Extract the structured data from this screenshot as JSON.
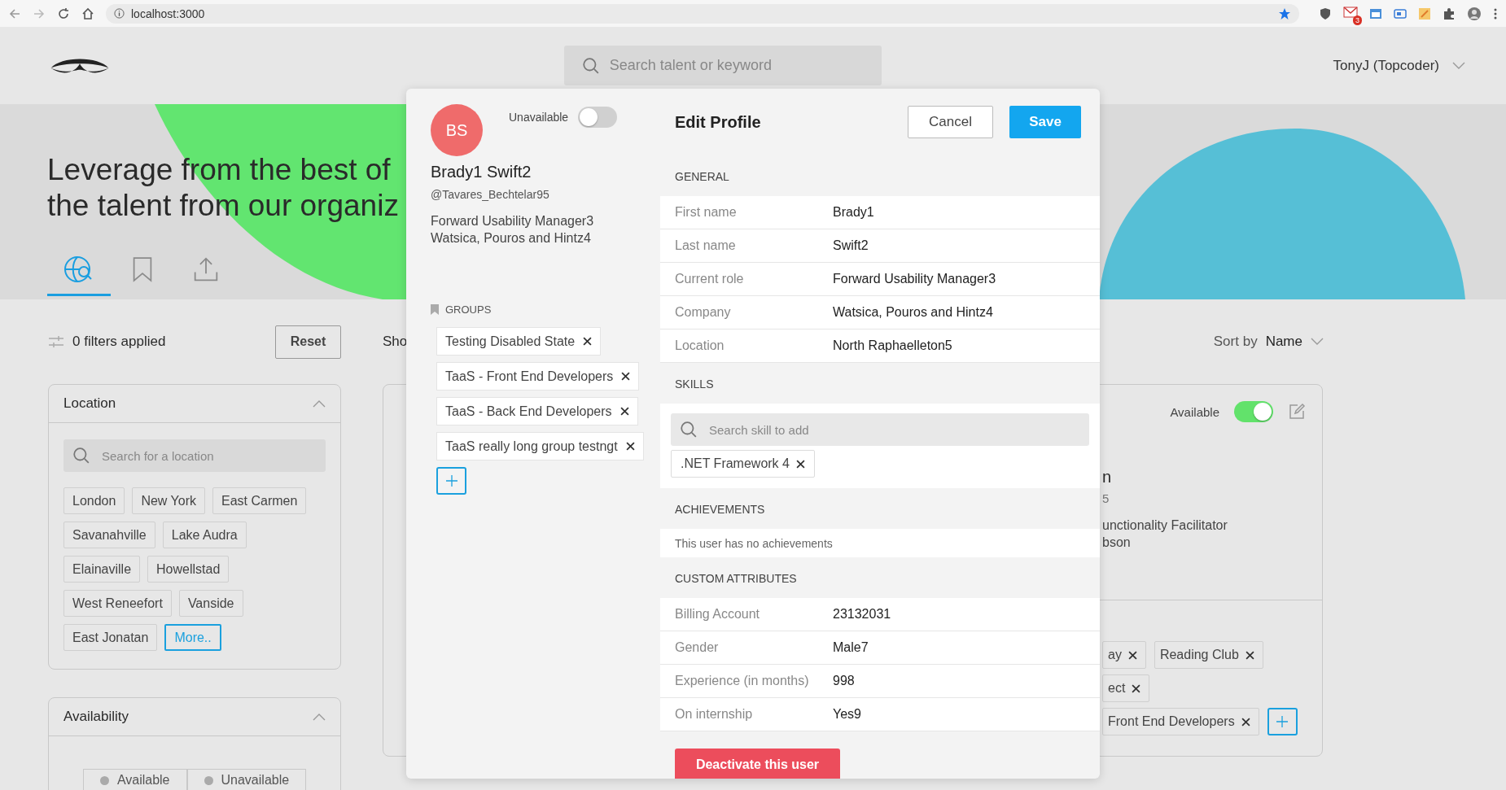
{
  "browser": {
    "url": "localhost:3000",
    "mail_badge": "3"
  },
  "header": {
    "search": {
      "placeholder": "Search talent or keyword"
    },
    "user": "TonyJ (Topcoder)"
  },
  "hero": {
    "headline_lines": [
      "Leverage from the best of",
      "the talent from our organiz"
    ],
    "tabs": [
      {
        "kind": "search",
        "selected": true
      },
      {
        "kind": "bookmark",
        "selected": false
      },
      {
        "kind": "upload",
        "selected": false
      }
    ]
  },
  "filters": {
    "summary": "0 filters applied",
    "reset": "Reset",
    "location": {
      "title": "Location",
      "expanded": true,
      "search": {
        "placeholder": "Search for a location"
      },
      "chips": [
        "London",
        "New York",
        "East Carmen",
        "Savanahville",
        "Lake Audra",
        "Elainaville",
        "Howellstad",
        "West Reneefort",
        "Vanside",
        "East Jonatan"
      ],
      "more": "More.."
    },
    "availability": {
      "title": "Availability",
      "expanded": true,
      "options": [
        {
          "label": "Available",
          "selected": false
        },
        {
          "label": "Unavailable",
          "selected": false
        }
      ]
    }
  },
  "results": {
    "summary": "Sho",
    "sort": {
      "label": "Sort by",
      "value": "Name"
    },
    "card": {
      "availability": {
        "label": "Available",
        "on": true
      },
      "name": "n",
      "handle": "5",
      "role": "unctionality Facilitator",
      "company": "bson",
      "groups": [
        "ay",
        "Reading Club",
        "ect",
        "Front End Developers"
      ]
    }
  },
  "modal": {
    "avatar": "BS",
    "availability": {
      "label": "Unavailable",
      "on": false
    },
    "name": "Brady1 Swift2",
    "handle": "@Tavares_Bechtelar95",
    "role": "Forward Usability Manager3",
    "company": "Watsica, Pouros and Hintz4",
    "groups_title": "GROUPS",
    "groups": [
      "Testing Disabled State",
      "TaaS - Front End Developers",
      "TaaS - Back End Developers",
      "TaaS really long group testngt"
    ],
    "title": "Edit Profile",
    "cancel": "Cancel",
    "save": "Save",
    "sections": [
      {
        "kind": "fields",
        "title": "GENERAL",
        "rows": [
          {
            "label": "First name",
            "value": "Brady1"
          },
          {
            "label": "Last name",
            "value": "Swift2"
          },
          {
            "label": "Current role",
            "value": "Forward Usability Manager3"
          },
          {
            "label": "Company",
            "value": "Watsica, Pouros and Hintz4"
          },
          {
            "label": "Location",
            "value": "North Raphaelleton5"
          }
        ]
      },
      {
        "kind": "skills",
        "title": "SKILLS",
        "search": {
          "placeholder": "Search skill to add"
        },
        "skills": [
          ".NET Framework 4"
        ]
      },
      {
        "kind": "message",
        "title": "ACHIEVEMENTS",
        "text": "This user has no achievements"
      },
      {
        "kind": "fields",
        "title": "CUSTOM ATTRIBUTES",
        "rows": [
          {
            "label": "Billing Account",
            "value": "23132031"
          },
          {
            "label": "Gender",
            "value": "Male7"
          },
          {
            "label": "Experience (in months)",
            "value": "998"
          },
          {
            "label": "On internship",
            "value": "Yes9"
          }
        ]
      }
    ],
    "deactivate": "Deactivate this user"
  }
}
